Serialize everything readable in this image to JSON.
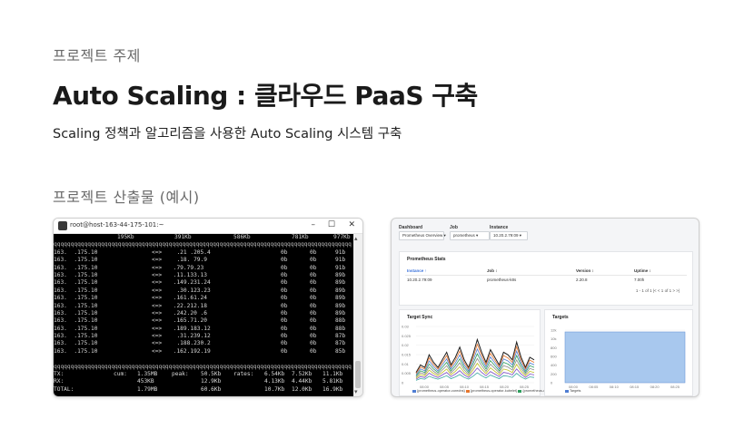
{
  "slide": {
    "topic_label": "프로젝트 주제",
    "title": "Auto Scaling : 클라우드 PaaS 구축",
    "description": "Scaling 정책과 알고리즘을 사용한 Auto Scaling 시스템 구축",
    "output_label": "프로젝트 산출물 (예시)"
  },
  "terminal": {
    "window_title": "root@host-163-44-175-101:~",
    "controls": {
      "minimize": "–",
      "maximize": "☐",
      "close": "✕"
    },
    "scale_labels": [
      "195Kb",
      "391Kb",
      "586Kb",
      "781Kb",
      "977Kb"
    ],
    "separator": "qqqqqqqqqqqqqqqqqqqqqqqqqqqqqqqqqqqqqqqqqqqqqqqqqqqqqqqqqqqqqqqqqqqqqqqqqqqqqqqqqqqqqqqq",
    "rows": [
      {
        "src": "163.  .175.10",
        "dir": "<=>",
        "dst": "  .21 .205.4",
        "a": "0b",
        "b": "0b",
        "c": "91b"
      },
      {
        "src": "163.  .175.10",
        "dir": "<=>",
        "dst": "  .18. 79.9",
        "a": "0b",
        "b": "0b",
        "c": "91b"
      },
      {
        "src": "163.  .175.10",
        "dir": "<=>",
        "dst": " .79.79.23",
        "a": "0b",
        "b": "0b",
        "c": "91b"
      },
      {
        "src": "163.  .175.10",
        "dir": "<=>",
        "dst": " .11.133.13",
        "a": "0b",
        "b": "0b",
        "c": "89b"
      },
      {
        "src": "163.  .175.10",
        "dir": "<=>",
        "dst": " .149.231.24",
        "a": "0b",
        "b": "0b",
        "c": "89b"
      },
      {
        "src": "163.  .175.10",
        "dir": "<=>",
        "dst": "  .30.123.23",
        "a": "0b",
        "b": "0b",
        "c": "89b"
      },
      {
        "src": "163.  .175.10",
        "dir": "<=>",
        "dst": " .161.61.24",
        "a": "0b",
        "b": "0b",
        "c": "89b"
      },
      {
        "src": "163.  .175.10",
        "dir": "<=>",
        "dst": " .22.212.18",
        "a": "0b",
        "b": "0b",
        "c": "89b"
      },
      {
        "src": "163.  .175.10",
        "dir": "<=>",
        "dst": " .242.20 .6",
        "a": "0b",
        "b": "0b",
        "c": "89b"
      },
      {
        "src": "163.  .175.10",
        "dir": "<=>",
        "dst": " .165.71.20",
        "a": "0b",
        "b": "0b",
        "c": "88b"
      },
      {
        "src": "163.  .175.10",
        "dir": "<=>",
        "dst": " .189.183.12",
        "a": "0b",
        "b": "0b",
        "c": "88b"
      },
      {
        "src": "163.  .175.10",
        "dir": "<=>",
        "dst": "  .31.239.12",
        "a": "0b",
        "b": "0b",
        "c": "87b"
      },
      {
        "src": "163.  .175.10",
        "dir": "<=>",
        "dst": "  .188.230.2",
        "a": "0b",
        "b": "0b",
        "c": "87b"
      },
      {
        "src": "163.  .175.10",
        "dir": "<=>",
        "dst": " .162.192.19",
        "a": "0b",
        "b": "0b",
        "c": "85b"
      }
    ],
    "totals": [
      {
        "label": "TX:",
        "cum_label": "cum:",
        "cum": "1.35MB",
        "peak_label": "peak:",
        "peak": "50.5Kb",
        "rates_label": "rates:",
        "r1": "6.54Kb",
        "r2": "7.52Kb",
        "r3": "11.1Kb"
      },
      {
        "label": "RX:",
        "cum_label": "",
        "cum": "453KB",
        "peak_label": "",
        "peak": "12.9Kb",
        "rates_label": "",
        "r1": "4.13Kb",
        "r2": "4.44Kb",
        "r3": "5.81Kb"
      },
      {
        "label": "TOTAL:",
        "cum_label": "",
        "cum": "1.79MB",
        "peak_label": "",
        "peak": "60.6Kb",
        "rates_label": "",
        "r1": "10.7Kb",
        "r2": "12.0Kb",
        "r3": "16.9Kb"
      }
    ]
  },
  "dashboard": {
    "filters": [
      {
        "label": "Dashboard",
        "value": "Prometheus Overview ▾"
      },
      {
        "label": "Job",
        "value": "prometheus ▾"
      },
      {
        "label": "Instance",
        "value": "10.20.2.79:09 ▾"
      }
    ],
    "stats_panel": {
      "title": "Prometheus Stats",
      "columns": [
        "Instance ↑",
        "Job ↕",
        "Version ↕",
        "Uptime ↕"
      ],
      "row": [
        "10.20.2.79:09",
        "prometheus-k8s",
        "2.20.8",
        "7.00h"
      ],
      "pager": "1 - 1 of 1   |<   <   1   of 1   >   >|"
    },
    "target_sync_panel": {
      "title": "Target Sync",
      "y_ticks": [
        "0.03",
        "0.025",
        "0.02",
        "0.015",
        "0.01",
        "0.005",
        "0"
      ],
      "x_ticks": [
        "08:00",
        "08:05",
        "08:10",
        "08:15",
        "08:20",
        "08:25"
      ],
      "legend": [
        "{prometheus-operator-coredns}",
        "{prometheus-operator-kubelet}",
        "{prometheus-operator-kube-state}"
      ],
      "colors": [
        "#1f1f1f",
        "#e6762e",
        "#4f7dd3",
        "#2e9e5e",
        "#8a8a8a",
        "#c0c020",
        "#7a4ac4",
        "#3aa7a0"
      ]
    },
    "targets_panel": {
      "title": "Targets",
      "y_ticks": [
        "12k",
        "10k",
        "800",
        "600",
        "400",
        "200",
        "0"
      ],
      "x_ticks": [
        "08:00",
        "08:05",
        "08:10",
        "08:15",
        "08:20",
        "08:25"
      ],
      "legend": [
        "Targets"
      ],
      "fill_color": "#a8c8ee"
    }
  }
}
